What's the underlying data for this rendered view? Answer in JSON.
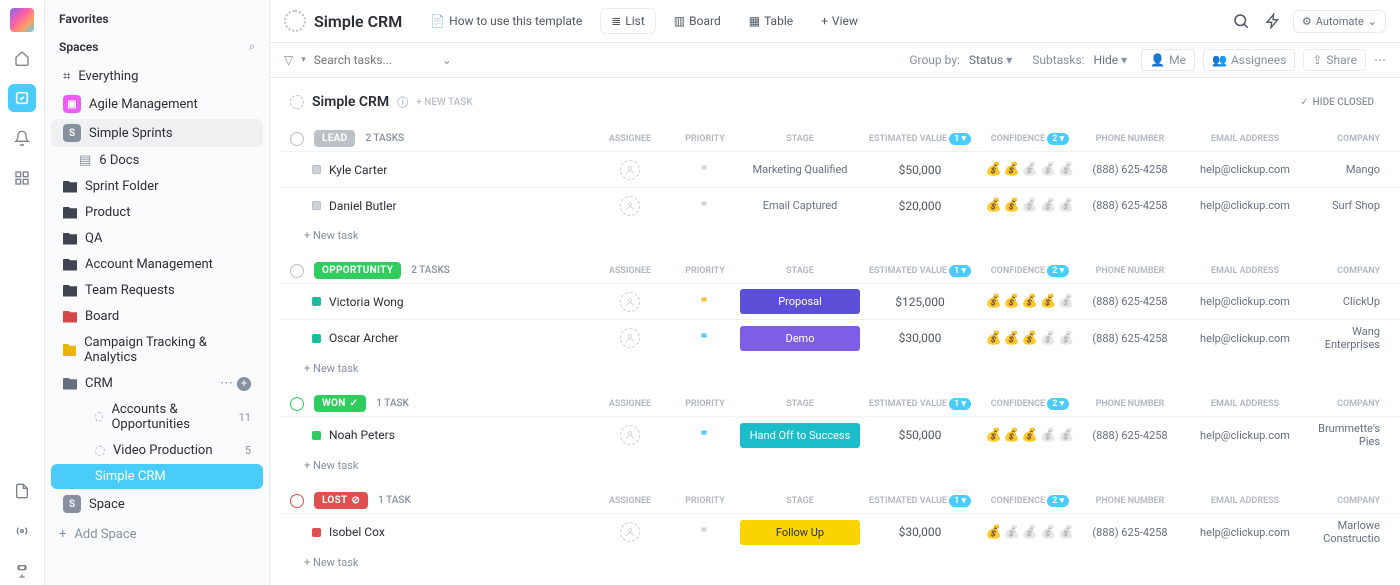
{
  "sidebar": {
    "favorites": "Favorites",
    "spaces": "Spaces",
    "everything": "Everything",
    "add_space": "Add Space",
    "items": {
      "agile": "Agile Management",
      "sprints": "Simple Sprints",
      "docs": "6 Docs",
      "sprint_folder": "Sprint Folder",
      "product": "Product",
      "qa": "QA",
      "account": "Account Management",
      "team_req": "Team Requests",
      "board": "Board",
      "campaign": "Campaign Tracking & Analytics",
      "crm": "CRM",
      "accounts_opp": "Accounts & Opportunities",
      "accounts_opp_count": "11",
      "video": "Video Production",
      "video_count": "5",
      "simple_crm": "Simple CRM",
      "space": "Space"
    }
  },
  "topbar": {
    "title": "Simple CRM",
    "howto": "How to use this template",
    "views": {
      "list": "List",
      "board": "Board",
      "table": "Table",
      "view": "View"
    },
    "automate": "Automate"
  },
  "filterbar": {
    "search_ph": "Search tasks...",
    "groupby": "Group by:",
    "groupby_val": "Status",
    "subtasks": "Subtasks:",
    "subtasks_val": "Hide",
    "me": "Me",
    "assignees": "Assignees",
    "share": "Share"
  },
  "list": {
    "title": "Simple CRM",
    "new_task": "+ NEW TASK",
    "hide_closed": "HIDE CLOSED",
    "cols": {
      "assignee": "Assignee",
      "priority": "Priority",
      "stage": "Stage",
      "est": "Estimated Value",
      "conf": "Confidence",
      "phone": "Phone Number",
      "email": "Email Address",
      "company": "Company"
    },
    "badge1": "1",
    "badge2": "2",
    "new_task_row": "+ New task"
  },
  "groups": [
    {
      "key": "lead",
      "label": "LEAD",
      "pill_class": "pill-lead",
      "sq": "sq-lead",
      "count": "2 TASKS",
      "tasks": [
        {
          "name": "Kyle Carter",
          "flag": "grey",
          "stage": "Marketing Qualified",
          "stage_class": "",
          "value": "$50,000",
          "conf": 2,
          "phone": "(888) 625-4258",
          "email": "help@clickup.com",
          "company": "Mango"
        },
        {
          "name": "Daniel Butler",
          "flag": "grey",
          "stage": "Email Captured",
          "stage_class": "",
          "value": "$20,000",
          "conf": 2,
          "phone": "(888) 625-4258",
          "email": "help@clickup.com",
          "company": "Surf Shop"
        }
      ]
    },
    {
      "key": "opportunity",
      "label": "OPPORTUNITY",
      "pill_class": "pill-opportunity",
      "sq": "sq-opp",
      "count": "2 TASKS",
      "tasks": [
        {
          "name": "Victoria Wong",
          "flag": "yellow",
          "stage": "Proposal",
          "stage_class": "proposal",
          "value": "$125,000",
          "conf": 4,
          "phone": "(888) 625-4258",
          "email": "help@clickup.com",
          "company": "ClickUp"
        },
        {
          "name": "Oscar Archer",
          "flag": "cyan",
          "stage": "Demo",
          "stage_class": "demo",
          "value": "$30,000",
          "conf": 3,
          "phone": "(888) 625-4258",
          "email": "help@clickup.com",
          "company": "Wang Enterprises"
        }
      ]
    },
    {
      "key": "won",
      "label": "WON",
      "pill_class": "pill-won",
      "sq": "sq-won",
      "count": "1 TASK",
      "tasks": [
        {
          "name": "Noah Peters",
          "flag": "cyan",
          "stage": "Hand Off to Success",
          "stage_class": "handoff",
          "value": "$50,000",
          "conf": 3,
          "phone": "(888) 625-4258",
          "email": "help@clickup.com",
          "company": "Brummette's Pies"
        }
      ]
    },
    {
      "key": "lost",
      "label": "LOST",
      "pill_class": "pill-lost",
      "sq": "sq-lost",
      "count": "1 TASK",
      "tasks": [
        {
          "name": "Isobel Cox",
          "flag": "grey",
          "stage": "Follow Up",
          "stage_class": "followup",
          "value": "$30,000",
          "conf": 1,
          "phone": "(888) 625-4258",
          "email": "help@clickup.com",
          "company": "Marlowe Constructio"
        }
      ]
    }
  ]
}
